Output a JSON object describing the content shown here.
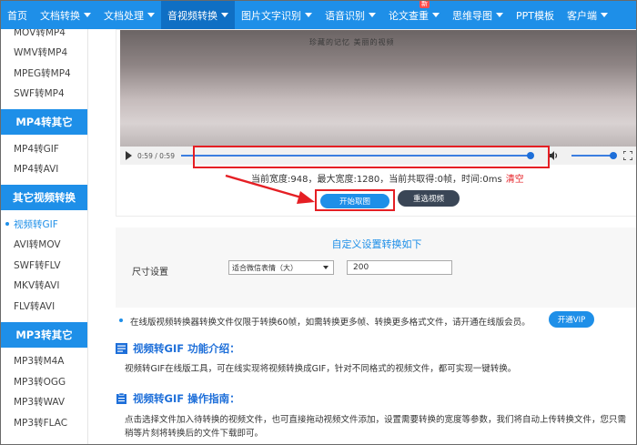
{
  "nav": {
    "items": [
      {
        "label": "首页",
        "caret": false
      },
      {
        "label": "文档转换",
        "caret": true
      },
      {
        "label": "文档处理",
        "caret": true
      },
      {
        "label": "音视频转换",
        "caret": true,
        "active": true
      },
      {
        "label": "图片文字识别",
        "caret": true
      },
      {
        "label": "语音识别",
        "caret": true
      },
      {
        "label": "论文查重",
        "caret": true,
        "badge": "新"
      },
      {
        "label": "思维导图",
        "caret": true
      },
      {
        "label": "PPT模板",
        "caret": false
      },
      {
        "label": "客户端",
        "caret": true
      }
    ]
  },
  "sidebar": {
    "group1": [
      "MOV转MP4",
      "WMV转MP4",
      "MPEG转MP4",
      "SWF转MP4"
    ],
    "head2": "MP4转其它",
    "group2": [
      "MP4转GIF",
      "MP4转AVI"
    ],
    "head3": "其它视频转换",
    "group3": [
      "视频转GIF",
      "AVI转MOV",
      "SWF转FLV",
      "MKV转AVI",
      "FLV转AVI"
    ],
    "head4": "MP3转其它",
    "group4": [
      "MP3转M4A",
      "MP3转OGG",
      "MP3转WAV",
      "MP3转FLAC"
    ]
  },
  "video": {
    "caption": "珍藏的记忆 美丽的视频",
    "time": "0:59 / 0:59",
    "progress": 1.0,
    "volume": 1.0
  },
  "capture": {
    "info": "当前宽度:948，最大宽度:1280，当前共取得:0帧，时间:0ms",
    "clear": "清空",
    "start_btn": "开始取图",
    "reselect_btn": "重选视频"
  },
  "settings": {
    "title": "自定义设置转换如下",
    "size_label": "尺寸设置",
    "size_option": "适合微信表情（大）",
    "size_value": "200"
  },
  "notice": {
    "text": "在线版视频转换器转换文件仅限于转换60帧，如需转换更多帧、转换更多格式文件，请开通在线版会员。",
    "vip_btn": "开通VIP"
  },
  "intro": {
    "title": "视频转GIF 功能介绍：",
    "text": "视频转GIF在线版工具，可在线实现将视频转换成GIF，针对不同格式的视频文件，都可实现一键转换。"
  },
  "guide": {
    "title": "视频转GIF 操作指南：",
    "text": "点击选择文件加入待转换的视频文件，也可直接拖动视频文件添加，设置需要转换的宽度等参数，我们将自动上传转换文件，您只需稍等片刻将转换后的文件下载即可。"
  },
  "colors": {
    "brand": "#1e8fe8",
    "highlight": "#e51f24"
  }
}
